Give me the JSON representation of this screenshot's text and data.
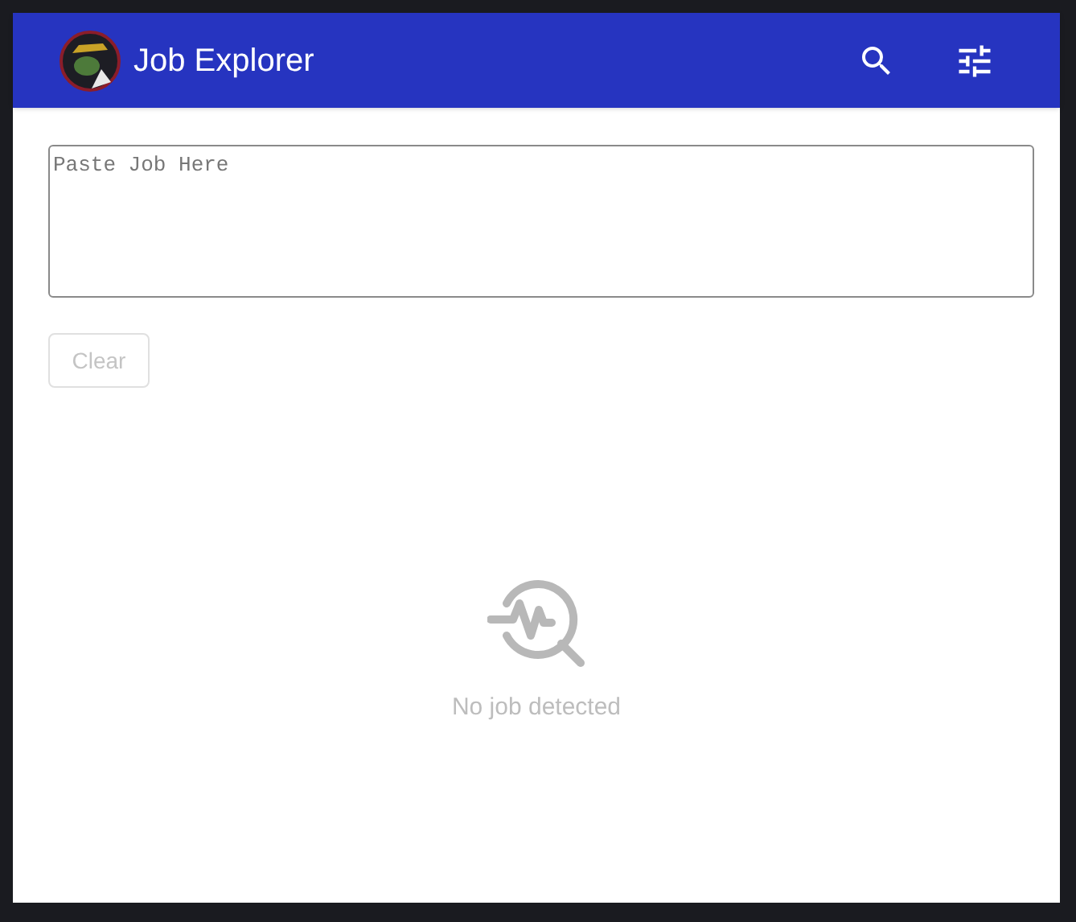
{
  "header": {
    "title": "Job Explorer"
  },
  "job_input": {
    "placeholder": "Paste Job Here"
  },
  "clear_button": {
    "label": "Clear",
    "disabled": true
  },
  "empty_state": {
    "message": "No job detected"
  }
}
